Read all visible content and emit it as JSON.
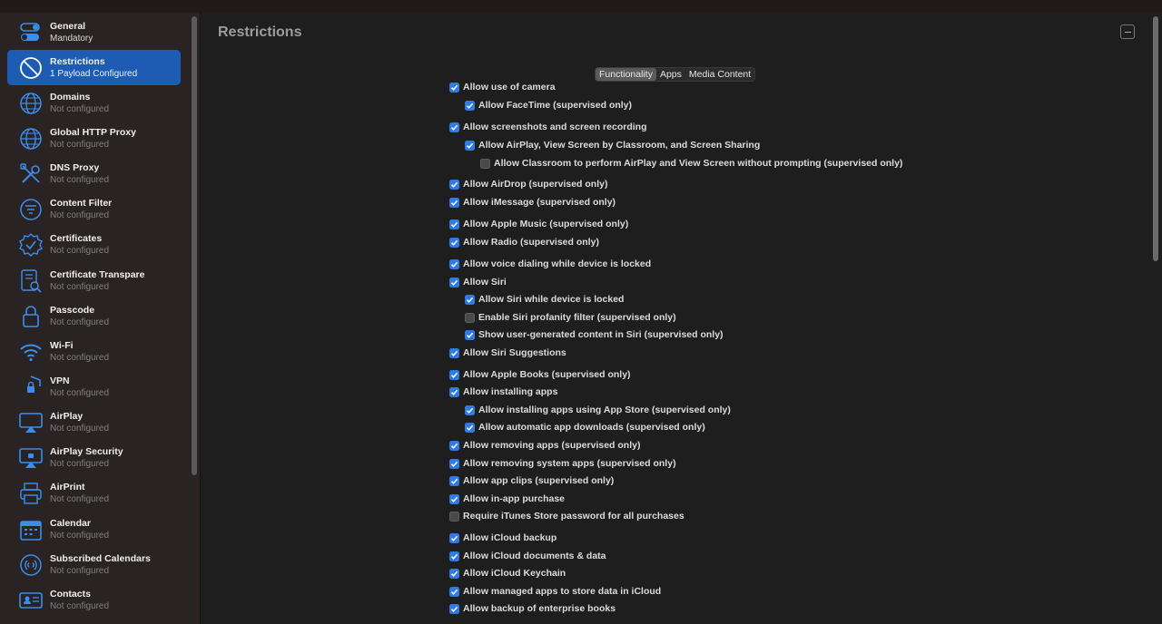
{
  "sidebar": {
    "items": [
      {
        "title": "General",
        "subtitle": "Mandatory",
        "icon": "toggle-icon"
      },
      {
        "title": "Restrictions",
        "subtitle": "1 Payload Configured",
        "icon": "prohibited-icon"
      },
      {
        "title": "Domains",
        "subtitle": "Not configured",
        "icon": "globe-icon"
      },
      {
        "title": "Global HTTP Proxy",
        "subtitle": "Not configured",
        "icon": "globe-icon"
      },
      {
        "title": "DNS Proxy",
        "subtitle": "Not configured",
        "icon": "tools-icon"
      },
      {
        "title": "Content Filter",
        "subtitle": "Not configured",
        "icon": "filter-icon"
      },
      {
        "title": "Certificates",
        "subtitle": "Not configured",
        "icon": "certificate-badge-icon"
      },
      {
        "title": "Certificate Transpare",
        "subtitle": "Not configured",
        "icon": "document-search-icon"
      },
      {
        "title": "Passcode",
        "subtitle": "Not configured",
        "icon": "lock-icon"
      },
      {
        "title": "Wi-Fi",
        "subtitle": "Not configured",
        "icon": "wifi-icon"
      },
      {
        "title": "VPN",
        "subtitle": "Not configured",
        "icon": "shield-lock-icon"
      },
      {
        "title": "AirPlay",
        "subtitle": "Not configured",
        "icon": "airplay-icon"
      },
      {
        "title": "AirPlay Security",
        "subtitle": "Not configured",
        "icon": "airplay-lock-icon"
      },
      {
        "title": "AirPrint",
        "subtitle": "Not configured",
        "icon": "printer-icon"
      },
      {
        "title": "Calendar",
        "subtitle": "Not configured",
        "icon": "calendar-icon"
      },
      {
        "title": "Subscribed Calendars",
        "subtitle": "Not configured",
        "icon": "subscribed-calendar-icon"
      },
      {
        "title": "Contacts",
        "subtitle": "Not configured",
        "icon": "contacts-card-icon"
      }
    ],
    "selected_index": 1
  },
  "main": {
    "title": "Restrictions",
    "tabs": [
      {
        "label": "Functionality",
        "active": true
      },
      {
        "label": "Apps",
        "active": false
      },
      {
        "label": "Media Content",
        "active": false
      }
    ],
    "options": [
      {
        "label": "Allow use of camera",
        "checked": true,
        "indent": 0
      },
      {
        "label": "Allow FaceTime (supervised only)",
        "checked": true,
        "indent": 1
      },
      {
        "label": "Allow screenshots and screen recording",
        "checked": true,
        "indent": 0
      },
      {
        "label": "Allow AirPlay, View Screen by Classroom, and Screen Sharing",
        "checked": true,
        "indent": 1
      },
      {
        "label": "Allow Classroom to perform AirPlay and View Screen without prompting (supervised only)",
        "checked": false,
        "indent": 2
      },
      {
        "label": "Allow AirDrop (supervised only)",
        "checked": true,
        "indent": 0
      },
      {
        "label": "Allow iMessage (supervised only)",
        "checked": true,
        "indent": 0
      },
      {
        "label": "Allow Apple Music (supervised only)",
        "checked": true,
        "indent": 0
      },
      {
        "label": "Allow Radio (supervised only)",
        "checked": true,
        "indent": 0
      },
      {
        "label": "Allow voice dialing while device is locked",
        "checked": true,
        "indent": 0
      },
      {
        "label": "Allow Siri",
        "checked": true,
        "indent": 0
      },
      {
        "label": "Allow Siri while device is locked",
        "checked": true,
        "indent": 1
      },
      {
        "label": "Enable Siri profanity filter (supervised only)",
        "checked": false,
        "indent": 1
      },
      {
        "label": "Show user-generated content in Siri (supervised only)",
        "checked": true,
        "indent": 1
      },
      {
        "label": "Allow Siri Suggestions",
        "checked": true,
        "indent": 0
      },
      {
        "label": "Allow Apple Books (supervised only)",
        "checked": true,
        "indent": 0
      },
      {
        "label": "Allow installing apps",
        "checked": true,
        "indent": 0
      },
      {
        "label": "Allow installing apps using App Store (supervised only)",
        "checked": true,
        "indent": 1
      },
      {
        "label": "Allow automatic app downloads (supervised only)",
        "checked": true,
        "indent": 1
      },
      {
        "label": "Allow removing apps (supervised only)",
        "checked": true,
        "indent": 0
      },
      {
        "label": "Allow removing system apps (supervised only)",
        "checked": true,
        "indent": 0
      },
      {
        "label": "Allow app clips (supervised only)",
        "checked": true,
        "indent": 0
      },
      {
        "label": "Allow in-app purchase",
        "checked": true,
        "indent": 0
      },
      {
        "label": "Require iTunes Store password for all purchases",
        "checked": false,
        "indent": 0
      },
      {
        "label": "Allow iCloud backup",
        "checked": true,
        "indent": 0
      },
      {
        "label": "Allow iCloud documents & data",
        "checked": true,
        "indent": 0
      },
      {
        "label": "Allow iCloud Keychain",
        "checked": true,
        "indent": 0
      },
      {
        "label": "Allow managed apps to store data in iCloud",
        "checked": true,
        "indent": 0
      },
      {
        "label": "Allow backup of enterprise books",
        "checked": true,
        "indent": 0
      }
    ]
  },
  "colors": {
    "accent": "#2f7ae5",
    "selection": "#1e5cb3",
    "icon": "#3a8ef0"
  }
}
